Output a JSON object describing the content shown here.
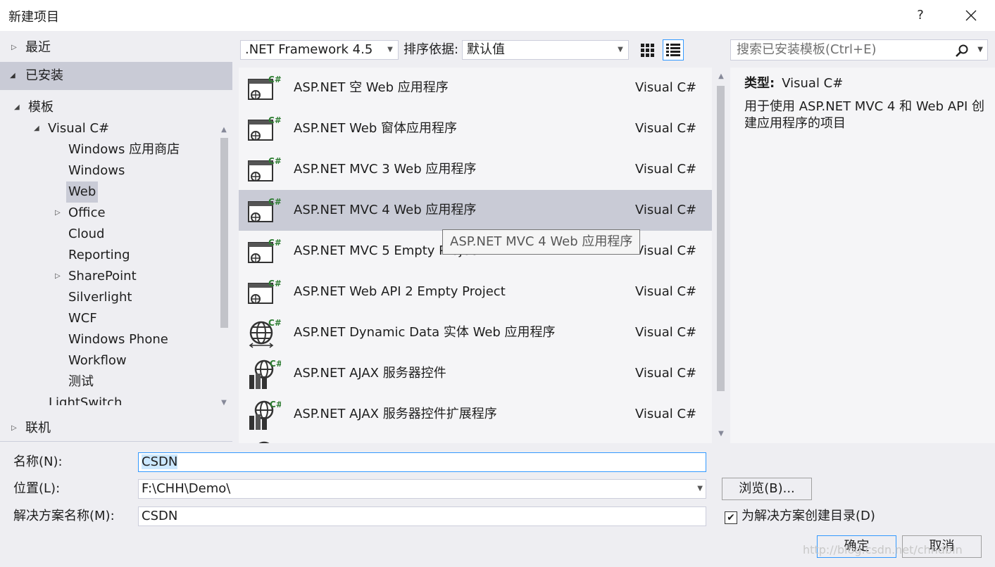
{
  "window": {
    "title": "新建项目",
    "help": "?",
    "close_icon": "close-icon"
  },
  "left_panel": {
    "recent": "最近",
    "installed": "已安装",
    "online": "联机",
    "tree": {
      "templates": "模板",
      "visual_csharp": "Visual C#",
      "children": [
        "Windows 应用商店",
        "Windows",
        "Web",
        "Office",
        "Cloud",
        "Reporting",
        "SharePoint",
        "Silverlight",
        "WCF",
        "Windows Phone",
        "Workflow",
        "测试",
        "LightSwitch"
      ],
      "selected": "Web"
    }
  },
  "toolbar": {
    "framework": ".NET Framework 4.5",
    "sort_label": "排序依据:",
    "sort_value": "默认值",
    "search_placeholder": "搜索已安装模板(Ctrl+E)"
  },
  "templates": [
    {
      "name": "ASP.NET 空 Web 应用程序",
      "lang": "Visual C#",
      "icon": "web-app-icon"
    },
    {
      "name": "ASP.NET Web 窗体应用程序",
      "lang": "Visual C#",
      "icon": "web-app-icon"
    },
    {
      "name": "ASP.NET MVC 3 Web 应用程序",
      "lang": "Visual C#",
      "icon": "web-app-icon"
    },
    {
      "name": "ASP.NET MVC 4 Web 应用程序",
      "lang": "Visual C#",
      "icon": "web-app-icon",
      "selected": true
    },
    {
      "name": "ASP.NET MVC 5 Empty Project",
      "lang": "Visual C#",
      "icon": "web-app-icon"
    },
    {
      "name": "ASP.NET Web API 2 Empty Project",
      "lang": "Visual C#",
      "icon": "web-app-icon"
    },
    {
      "name": "ASP.NET Dynamic Data 实体 Web 应用程序",
      "lang": "Visual C#",
      "icon": "globe-icon"
    },
    {
      "name": "ASP.NET AJAX 服务器控件",
      "lang": "Visual C#",
      "icon": "globe-library-icon"
    },
    {
      "name": "ASP.NET AJAX 服务器控件扩展程序",
      "lang": "Visual C#",
      "icon": "globe-library-icon"
    }
  ],
  "tooltip": "ASP.NET MVC 4 Web 应用程序",
  "details": {
    "type_label": "类型:",
    "type_value": "Visual C#",
    "description": "用于使用 ASP.NET MVC 4 和 Web API 创建应用程序的项目"
  },
  "form": {
    "name_label": "名称(N):",
    "name_value": "CSDN",
    "location_label": "位置(L):",
    "location_value": "F:\\CHH\\Demo\\",
    "solution_label": "解决方案名称(M):",
    "solution_value": "CSDN",
    "browse": "浏览(B)...",
    "create_dir": "为解决方案创建目录(D)",
    "create_dir_checked": true,
    "ok": "确定",
    "cancel": "取消"
  },
  "watermark": "http://blog.csdn.net/chhdbln"
}
